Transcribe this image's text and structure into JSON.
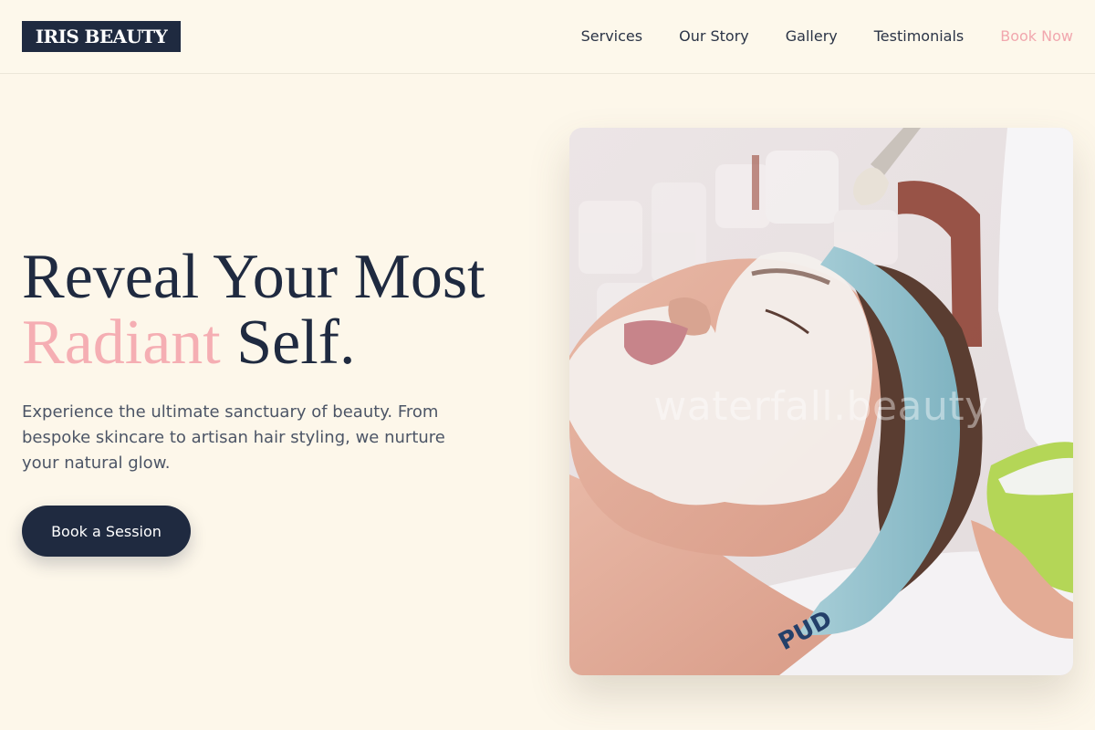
{
  "brand": {
    "name": "IRIS BEAUTY"
  },
  "nav": {
    "items": [
      "Services",
      "Our Story",
      "Gallery",
      "Testimonials"
    ],
    "cta_label": "Book Now"
  },
  "hero": {
    "title_line1": "Reveal Your Most",
    "title_accent": "Radiant",
    "title_line2_rest": " Self.",
    "subtitle": "Experience the ultimate sanctuary of beauty. From bespoke skincare to artisan hair styling, we nurture your natural glow.",
    "cta_label": "Book a Session"
  },
  "image": {
    "watermark": "waterfall.beauty",
    "headband_text": "PUD"
  },
  "colors": {
    "navy": "#1f2a40",
    "accent_pink": "#f5aeb3",
    "background_cream": "#fdf7ea"
  }
}
